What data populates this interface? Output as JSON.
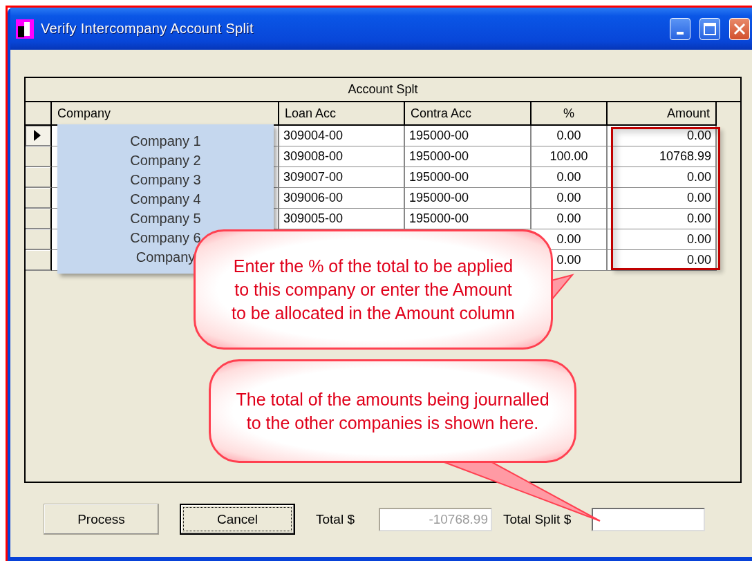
{
  "window": {
    "title": "Verify Intercompany Account Split"
  },
  "grid": {
    "title": "Account Splt",
    "columns": [
      "Company",
      "Loan Acc",
      "Contra Acc",
      "%",
      "Amount"
    ],
    "rows": [
      {
        "selected": true,
        "loan_acc": "309004-00",
        "contra_acc": "195000-00",
        "percent": "0.00",
        "amount": "0.00"
      },
      {
        "selected": false,
        "loan_acc": "309008-00",
        "contra_acc": "195000-00",
        "percent": "100.00",
        "amount": "10768.99"
      },
      {
        "selected": false,
        "loan_acc": "309007-00",
        "contra_acc": "195000-00",
        "percent": "0.00",
        "amount": "0.00"
      },
      {
        "selected": false,
        "loan_acc": "309006-00",
        "contra_acc": "195000-00",
        "percent": "0.00",
        "amount": "0.00"
      },
      {
        "selected": false,
        "loan_acc": "309005-00",
        "contra_acc": "195000-00",
        "percent": "0.00",
        "amount": "0.00"
      },
      {
        "selected": false,
        "percent": "0.00",
        "amount": "0.00"
      },
      {
        "selected": false,
        "percent": "0.00",
        "amount": "0.00"
      }
    ]
  },
  "company_list": [
    "Company 1",
    "Company 2",
    "Company 3",
    "Company 4",
    "Company 5",
    "Company 6",
    "Company"
  ],
  "callouts": [
    "Enter the % of the total to be applied to this company or enter the Amount to be allocated in the Amount column",
    "The total of the amounts being journalled to the other companies is shown here."
  ],
  "footer": {
    "buttons": [
      {
        "label": "Process",
        "focused": false
      },
      {
        "label": "Cancel",
        "focused": true
      }
    ],
    "totals": [
      {
        "label": "Total $",
        "value": "-10768.99",
        "disabled": true
      },
      {
        "label": "Total Split $",
        "disabled": false
      }
    ]
  }
}
